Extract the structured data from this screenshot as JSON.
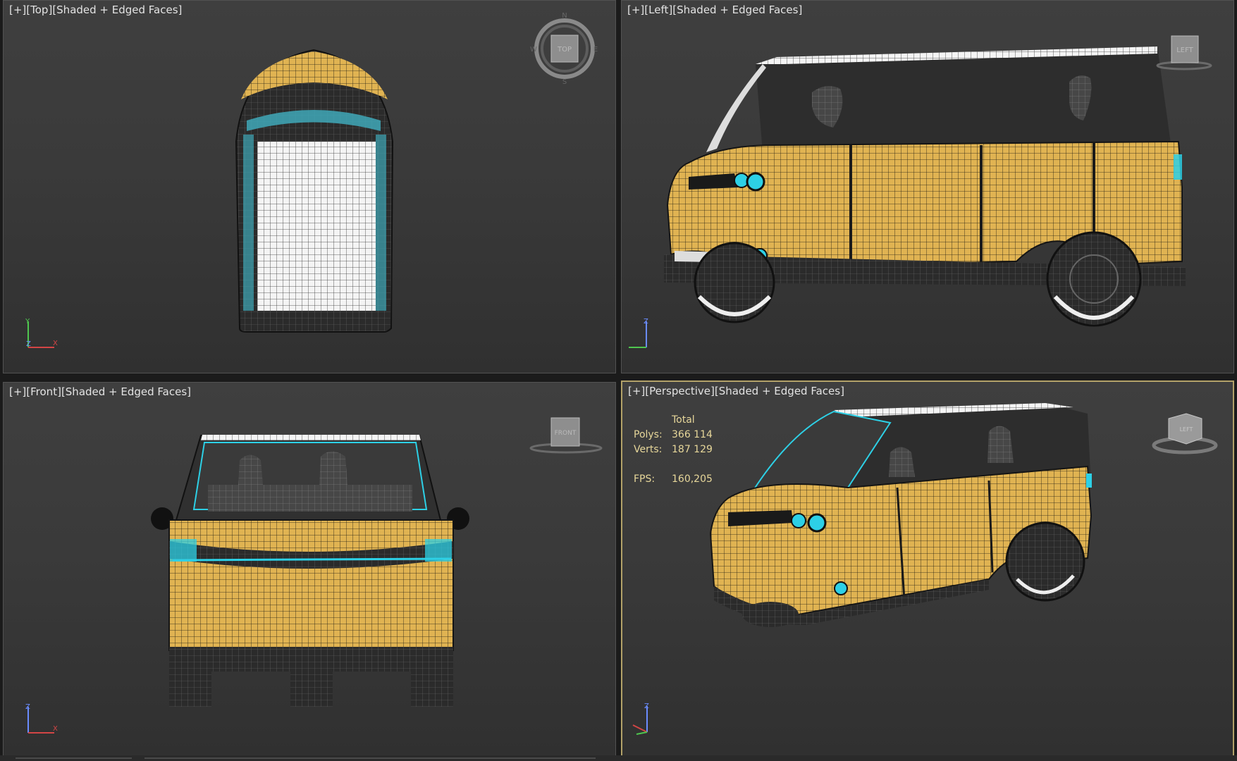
{
  "viewports": [
    {
      "id": "top",
      "label": {
        "menu": "[+]",
        "view": "[Top]",
        "mode": "[Shaded + Edged Faces]"
      },
      "viewcube": "TOP",
      "axes": [
        "Y",
        "Z",
        "X"
      ]
    },
    {
      "id": "left",
      "label": {
        "menu": "[+]",
        "view": "[Left]",
        "mode": "[Shaded + Edged Faces]"
      },
      "viewcube": "LEFT",
      "axes": [
        "Z"
      ]
    },
    {
      "id": "front",
      "label": {
        "menu": "[+]",
        "view": "[Front]",
        "mode": "[Shaded + Edged Faces]"
      },
      "viewcube": "FRONT",
      "axes": [
        "Z",
        "X"
      ]
    },
    {
      "id": "perspective",
      "label": {
        "menu": "[+]",
        "view": "[Perspective]",
        "mode": "[Shaded + Edged Faces]"
      },
      "viewcube": "LEFT",
      "axes": [
        "Z"
      ],
      "active": true
    }
  ],
  "stats": {
    "header": "Total",
    "polys_label": "Polys:",
    "polys_value": "366 114",
    "verts_label": "Verts:",
    "verts_value": "187 129",
    "fps_label": "FPS:",
    "fps_value": "160,205"
  },
  "colors": {
    "body_yellow": "#e2b452",
    "glass_cyan": "#52c8dc",
    "active_border": "#b3a269",
    "stats_text": "#e7d79a"
  }
}
